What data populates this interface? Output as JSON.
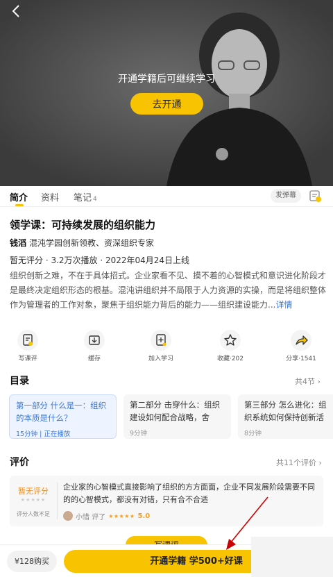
{
  "video": {
    "overlay_message": "开通学籍后可继续学习",
    "open_button": "去开通"
  },
  "tabs": [
    {
      "label": "简介",
      "count": ""
    },
    {
      "label": "资料",
      "count": ""
    },
    {
      "label": "笔记",
      "count": "4"
    }
  ],
  "danmu_label": "发弹幕",
  "course": {
    "title": "领学课：可持续发展的组织能力",
    "teacher_name": "钱滔",
    "teacher_title": "混沌学园创新领教、资深组织专家",
    "stats": "暂无评分 · 3.2万次播放 · 2022年04月24日上线",
    "description": "组织创新之难，不在于具体招式。企业家看不见、摸不着的心智模式和意识进化阶段才是最终决定组织形态的根基。混沌讲组织并不局限于人力资源的实操，而是将组织整体作为管理者的工作对象，聚焦于组织能力背后的能力——组织建设能力...",
    "more_link": "详情"
  },
  "actions": [
    {
      "icon": "write-review-icon",
      "label": "写课评"
    },
    {
      "icon": "download-icon",
      "label": "缓存"
    },
    {
      "icon": "add-study-icon",
      "label": "加入学习"
    },
    {
      "icon": "star-icon",
      "label": "收藏·202"
    },
    {
      "icon": "share-icon",
      "label": "分享·1541"
    }
  ],
  "catalog": {
    "title": "目录",
    "more": "共4节 ›",
    "items": [
      {
        "title": "第一部分 什么是一：组织的本质是什么？",
        "meta": "15分钟 | 正在播放"
      },
      {
        "title": "第二部分 击穿什么：组织建设如何配合战略，舍九...",
        "meta": "9分钟"
      },
      {
        "title": "第三部分 怎么进化：组织系统如何保持创新活力?",
        "meta": "8分钟"
      }
    ]
  },
  "reviews": {
    "title": "评价",
    "more": "共11个评价 ›",
    "no_score": "暂无评分",
    "gray_stars": "★★★★★",
    "score_note": "评分人数不足",
    "text": "企业家的心智模式直接影响了组织的方方面面，企业不同发展阶段需要不同的的心智模式，都没有对错，只有合不合适",
    "reviewer": "小惜 评了",
    "stars": "★★★★★",
    "score": "5.0"
  },
  "bottom": {
    "write_review": "写课评",
    "buy_label": "¥128购买",
    "vip_label": "开通学籍 学500+好课"
  },
  "colors": {
    "accent": "#f8c300",
    "link": "#3a78d8",
    "warning": "#f08a1c",
    "annotation": "#cc0000"
  }
}
